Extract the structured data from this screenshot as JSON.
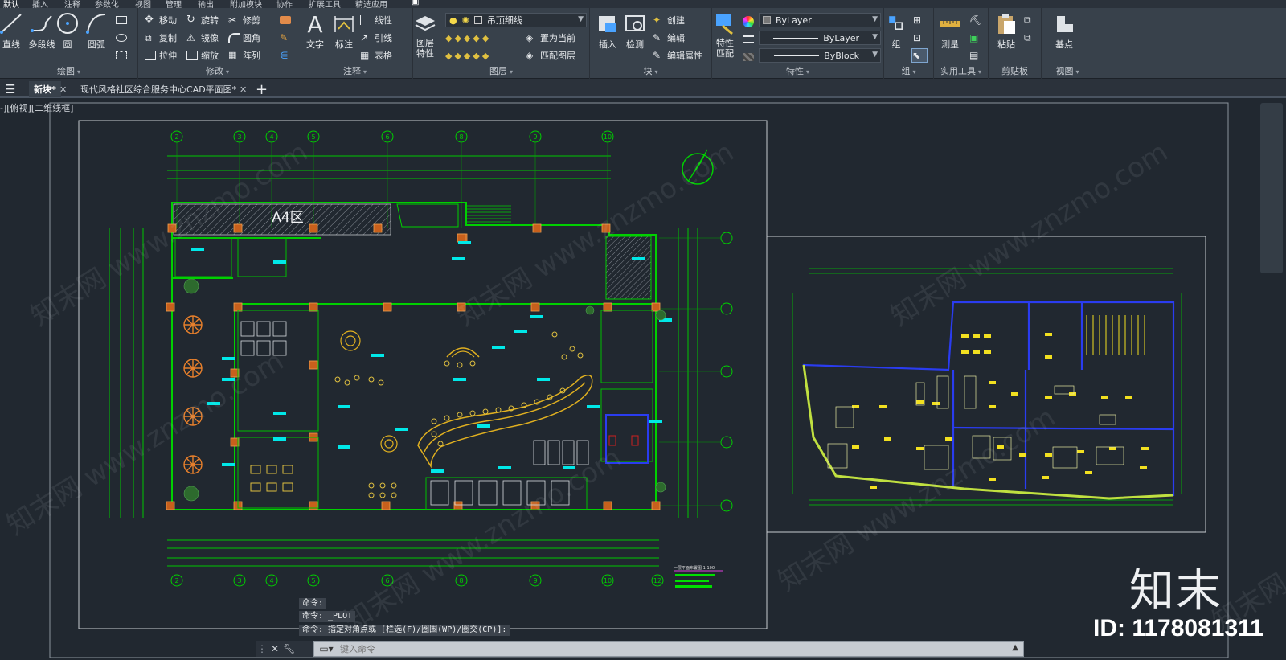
{
  "menu_tabs": [
    "默认",
    "插入",
    "注释",
    "参数化",
    "视图",
    "管理",
    "输出",
    "附加模块",
    "协作",
    "扩展工具",
    "精选应用"
  ],
  "ribbon": {
    "draw": {
      "title": "绘图",
      "line": "直线",
      "polyline": "多段线",
      "circle": "圆",
      "arc": "圆弧"
    },
    "modify": {
      "title": "修改",
      "move": "移动",
      "rotate": "旋转",
      "trim": "修剪",
      "copy": "复制",
      "mirror": "镜像",
      "fillet": "圆角",
      "stretch": "拉伸",
      "scale": "缩放",
      "array": "阵列"
    },
    "annotation": {
      "title": "注释",
      "text": "文字",
      "dimension": "标注",
      "linear": "线性",
      "leader": "引线",
      "table": "表格"
    },
    "layers": {
      "title": "图层",
      "layer_properties": "图层\n特性",
      "layer_properties_1": "图层",
      "layer_properties_2": "特性",
      "current_layer": "吊顶细线",
      "make_current": "置为当前",
      "match_layer": "匹配图层"
    },
    "block": {
      "title": "块",
      "insert": "插入",
      "inspect": "检测",
      "create": "创建",
      "edit": "编辑",
      "edit_attributes": "编辑属性"
    },
    "properties": {
      "title": "特性",
      "match_1": "特性",
      "match_2": "匹配",
      "color": "ByLayer",
      "linetype": "ByLayer",
      "lineweight": "ByBlock"
    },
    "groups": {
      "title": "组",
      "group": "组"
    },
    "utilities": {
      "title": "实用工具",
      "measure": "测量"
    },
    "clipboard": {
      "title": "剪贴板",
      "paste": "粘贴"
    },
    "view": {
      "title": "视图",
      "base": "基点"
    }
  },
  "file_tabs": [
    {
      "label": "新块*",
      "active": true
    },
    {
      "label": "现代风格社区综合服务中心CAD平面图*",
      "active": false
    }
  ],
  "viewport_label": "-][俯视][二维线框]",
  "drawing": {
    "zone_label": "A4区",
    "top_dims": [
      "7200",
      "8400",
      "8400",
      "8400",
      "8400",
      "8400",
      "7200"
    ],
    "bottom_total": "54675",
    "grid_axes": [
      "2",
      "3",
      "4",
      "5",
      "6",
      "8",
      "9",
      "10",
      "12"
    ],
    "legend_title": "一层平面布置图 1:100"
  },
  "command": {
    "history": [
      "命令:",
      "命令: _PLOT",
      "命令: 指定对角点或 [栏选(F)/圈围(WP)/圈交(CP)]:"
    ],
    "placeholder": "键入命令"
  },
  "watermark": {
    "logo": "知末",
    "id": "ID: 1178081311",
    "diag": "知末网 www.znzmo.com"
  },
  "colors": {
    "ribbon_bg": "#38414b",
    "canvas_bg": "#212830",
    "cad_green": "#00d000",
    "cad_yellow": "#f0e020",
    "cad_orange": "#e87f30",
    "cad_cyan": "#00e8e8",
    "cad_blue": "#2a3cf0"
  }
}
